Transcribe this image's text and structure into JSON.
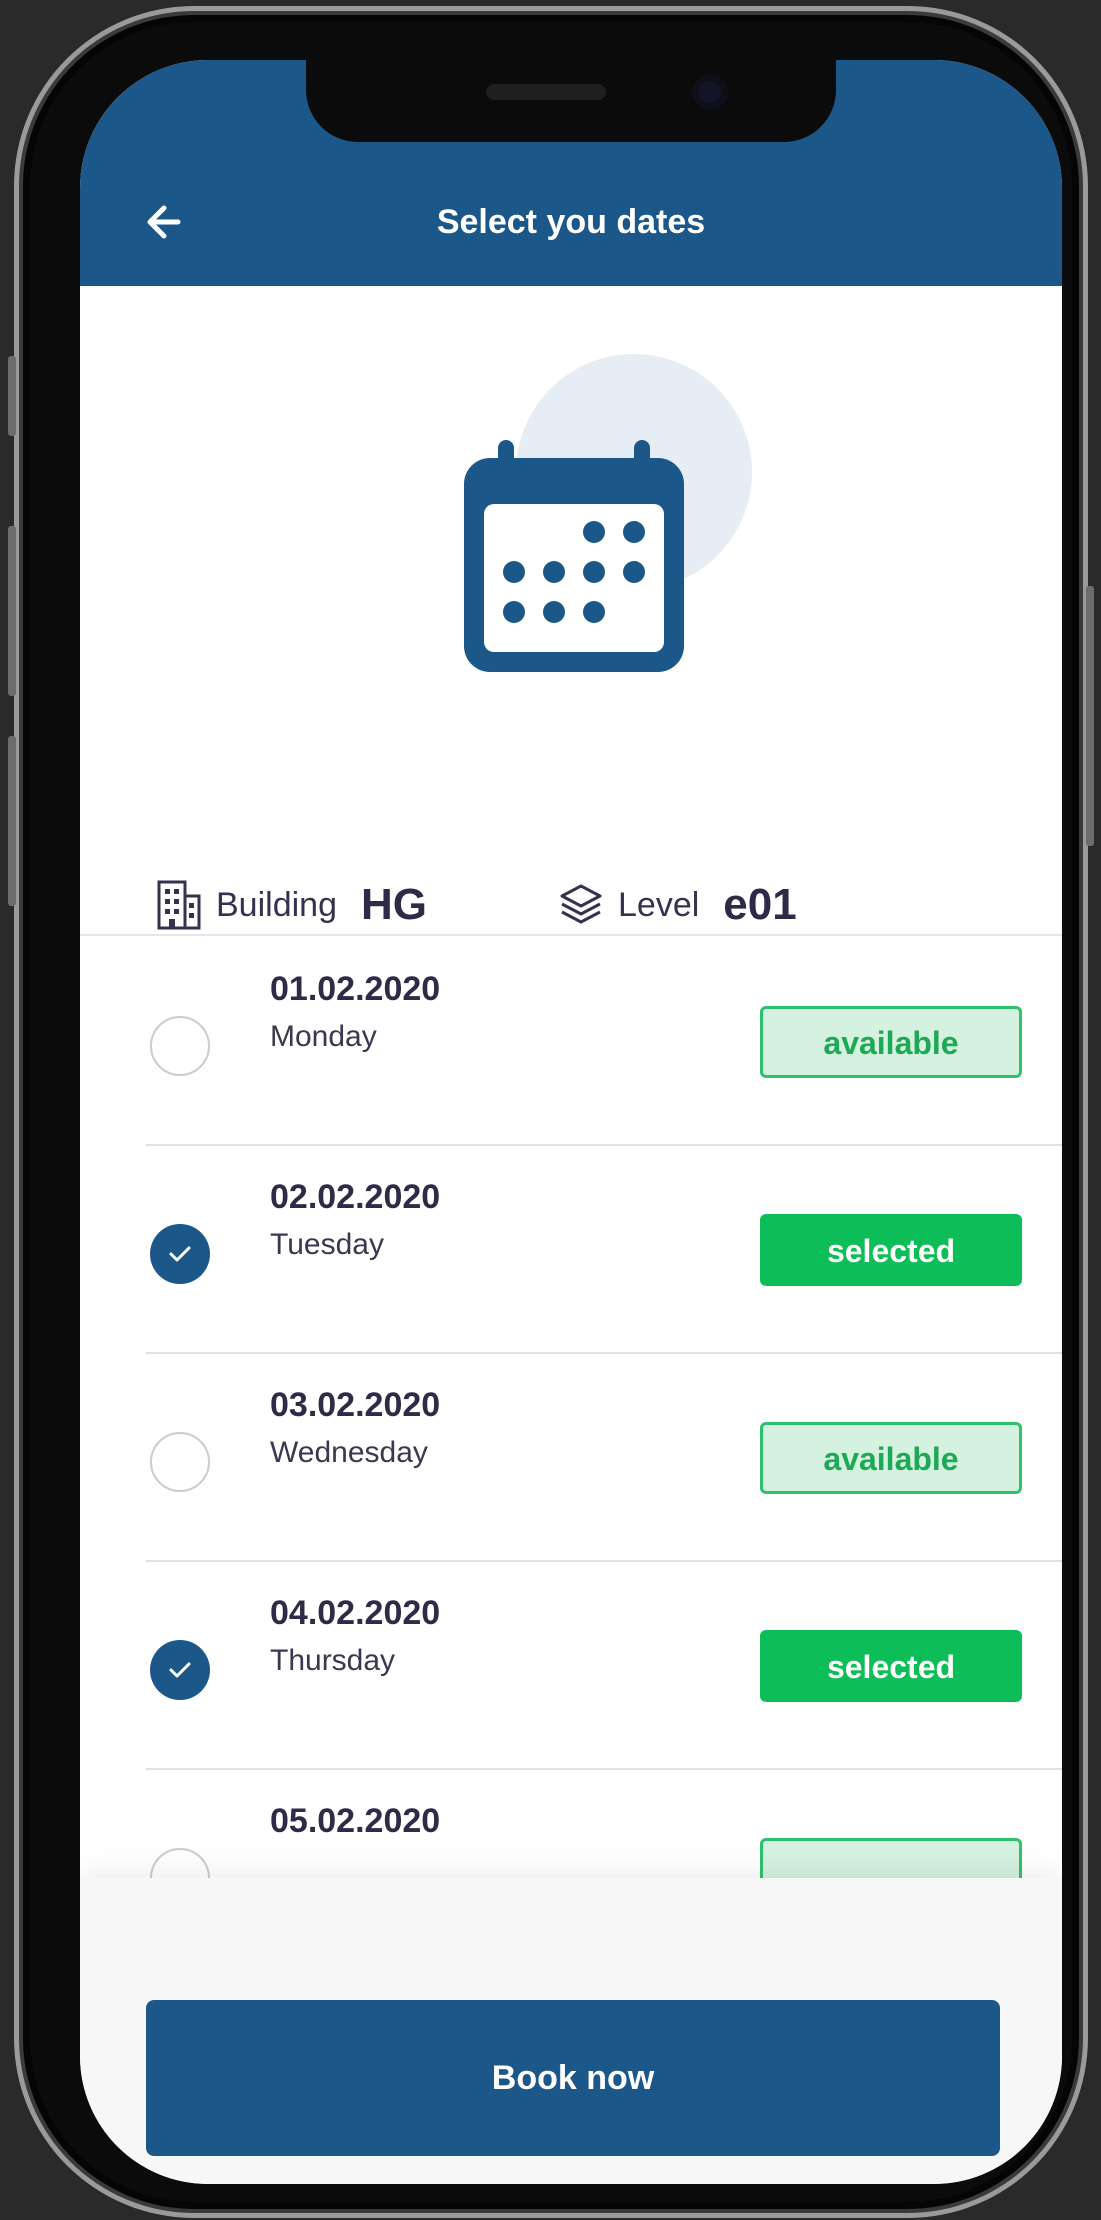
{
  "header": {
    "title": "Select you dates",
    "back_icon": "arrow-left-icon",
    "background_color": "#1c578a"
  },
  "hero": {
    "icon": "calendar-icon"
  },
  "location": {
    "building_icon": "building-icon",
    "building_label": "Building",
    "building_value": "HG",
    "level_icon": "layers-icon",
    "level_label": "Level",
    "level_value": "e01"
  },
  "dates": [
    {
      "date": "01.02.2020",
      "day": "Monday",
      "status": "available",
      "checked": false
    },
    {
      "date": "02.02.2020",
      "day": "Tuesday",
      "status": "selected",
      "checked": true
    },
    {
      "date": "03.02.2020",
      "day": "Wednesday",
      "status": "available",
      "checked": false
    },
    {
      "date": "04.02.2020",
      "day": "Thursday",
      "status": "selected",
      "checked": true
    },
    {
      "date": "05.02.2020",
      "day": "",
      "status": "",
      "checked": false
    }
  ],
  "colors": {
    "available_border": "#2ec26a",
    "available_fill": "#d5f1df",
    "selected_fill": "#0dbd57"
  },
  "footer": {
    "book_label": "Book now"
  }
}
